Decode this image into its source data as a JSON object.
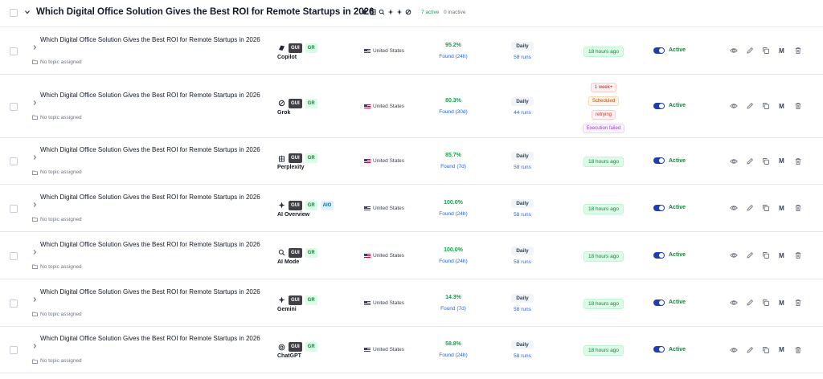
{
  "group": {
    "title": "Which Digital Office Solution Gives the Best ROI for Remote Startups in 2026",
    "engine_icons": [
      "copilot-icon",
      "perplexity-icon",
      "ai-mode-icon",
      "ai-overview-icon",
      "gemini-icon",
      "grok-icon"
    ],
    "active_count": "7 active",
    "inactive_count": "0 inactive"
  },
  "rows": [
    {
      "title": "Which Digital Office Solution Gives the Best ROI for Remote Startups in 2026",
      "topic": "No topic assigned",
      "engine": "Copilot",
      "engine_icon": "copilot-icon",
      "tags": [
        "GUI",
        "GR"
      ],
      "country": "United States",
      "percent": "95.2%",
      "found": "Found (24h)",
      "frequency": "Daily",
      "runs": "58 runs",
      "last_run": "18 hours ago",
      "status": "Active"
    },
    {
      "title": "Which Digital Office Solution Gives the Best ROI for Remote Startups in 2026",
      "topic": "No topic assigned",
      "engine": "Grok",
      "engine_icon": "grok-icon",
      "tags": [
        "GUI",
        "GR"
      ],
      "country": "United States",
      "percent": "80.3%",
      "found": "Found (30d)",
      "frequency": "Daily",
      "runs": "44 runs",
      "status_pills": [
        "1 week+",
        "Scheduled",
        "retrying",
        "Execution failed"
      ],
      "status": "Active"
    },
    {
      "title": "Which Digital Office Solution Gives the Best ROI for Remote Startups in 2026",
      "topic": "No topic assigned",
      "engine": "Perplexity",
      "engine_icon": "perplexity-icon",
      "tags": [
        "GUI",
        "GR"
      ],
      "country": "United States",
      "percent": "85.7%",
      "found": "Found (7d)",
      "frequency": "Daily",
      "runs": "58 runs",
      "last_run": "18 hours ago",
      "status": "Active"
    },
    {
      "title": "Which Digital Office Solution Gives the Best ROI for Remote Startups in 2026",
      "topic": "No topic assigned",
      "engine": "AI Overview",
      "engine_icon": "ai-overview-icon",
      "tags": [
        "GUI",
        "GR",
        "AIO"
      ],
      "country": "United States",
      "percent": "100.0%",
      "found": "Found (24h)",
      "frequency": "Daily",
      "runs": "58 runs",
      "last_run": "18 hours ago",
      "status": "Active"
    },
    {
      "title": "Which Digital Office Solution Gives the Best ROI for Remote Startups in 2026",
      "topic": "No topic assigned",
      "engine": "AI Mode",
      "engine_icon": "ai-mode-icon",
      "tags": [
        "GUI",
        "GR"
      ],
      "country": "United States",
      "percent": "100.0%",
      "found": "Found (24h)",
      "frequency": "Daily",
      "runs": "58 runs",
      "last_run": "18 hours ago",
      "status": "Active"
    },
    {
      "title": "Which Digital Office Solution Gives the Best ROI for Remote Startups in 2026",
      "topic": "No topic assigned",
      "engine": "Gemini",
      "engine_icon": "gemini-icon",
      "tags": [
        "GUI",
        "GR"
      ],
      "country": "United States",
      "percent": "14.3%",
      "found": "Found (7d)",
      "frequency": "Daily",
      "runs": "58 runs",
      "last_run": "18 hours ago",
      "status": "Active"
    },
    {
      "title": "Which Digital Office Solution Gives the Best ROI for Remote Startups in 2026",
      "topic": "No topic assigned",
      "engine": "ChatGPT",
      "engine_icon": "chatgpt-icon",
      "tags": [
        "GUI",
        "GR"
      ],
      "country": "United States",
      "percent": "58.8%",
      "found": "Found (24h)",
      "frequency": "Daily",
      "runs": "58 runs",
      "last_run": "18 hours ago",
      "status": "Active"
    }
  ],
  "row_action_icons": [
    "eye-icon",
    "edit-icon",
    "copy-icon",
    "m-button",
    "trash-icon"
  ],
  "row_action_m_label": "M",
  "colors": {
    "accent": "#1e40af",
    "success": "#16a34a",
    "danger": "#dc2626",
    "link": "#2563eb"
  }
}
